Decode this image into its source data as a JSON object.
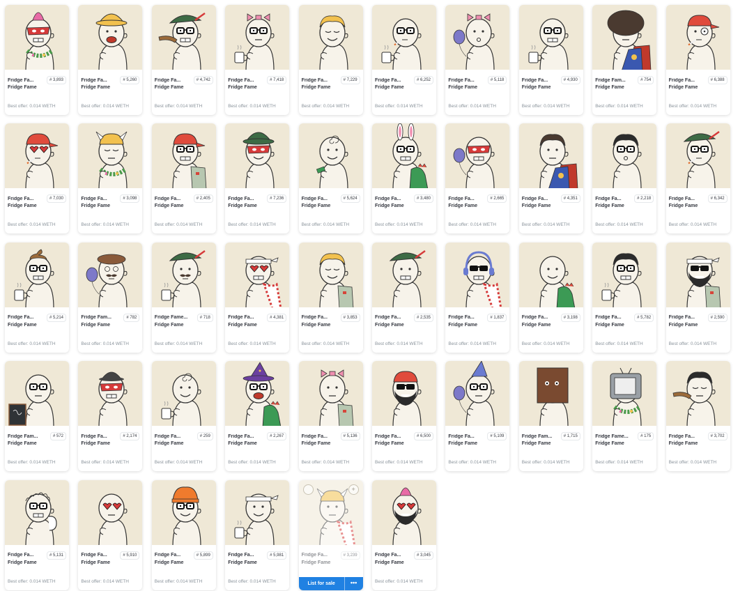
{
  "collection": "Fridge Fame",
  "offer_text": "Best offer: 0.014 WETH",
  "hover_actions": {
    "list_for_sale": "List for sale",
    "more": "•••",
    "left_icon": "circle-icon",
    "right_icon": "plus-icon"
  },
  "hovered_index": 44,
  "items": [
    {
      "name": "Fridge Fa...",
      "number": "# 3,893",
      "hat": "mohawk",
      "hatColor": "#e86aa6",
      "eyes": "mask",
      "mouth": "teeth",
      "extra": "lei"
    },
    {
      "name": "Fridge Fa...",
      "number": "# 5,260",
      "hat": "bucket",
      "hatColor": "#f2c14e",
      "eyes": "dots",
      "mouth": "open",
      "extra": ""
    },
    {
      "name": "Fridge Fa...",
      "number": "# 4,742",
      "hat": "feather",
      "hatColor": "#3d6b45",
      "eyes": "glasses",
      "mouth": "teeth",
      "extra": "boomerang"
    },
    {
      "name": "Fridge Fa...",
      "number": "# 7,418",
      "hat": "bow",
      "hatColor": "#f08fb0",
      "eyes": "glasses",
      "mouth": "flat",
      "extra": "mug"
    },
    {
      "name": "Fridge Fa...",
      "number": "# 7,229",
      "hat": "hair",
      "hatColor": "#f2c14e",
      "eyes": "closed",
      "mouth": "smile",
      "extra": ""
    },
    {
      "name": "Fridge Fa...",
      "number": "# 6,252",
      "hat": "none",
      "hatColor": "",
      "eyes": "glasses",
      "mouth": "cig",
      "extra": "mug"
    },
    {
      "name": "Fridge Fa...",
      "number": "# 5,118",
      "hat": "bow",
      "hatColor": "#f08fb0",
      "eyes": "dots",
      "mouth": "o",
      "extra": "balloon"
    },
    {
      "name": "Fridge Fa...",
      "number": "# 4,930",
      "hat": "none",
      "hatColor": "",
      "eyes": "glasses",
      "mouth": "teeth",
      "extra": "mug"
    },
    {
      "name": "Fridge Fam...",
      "number": "# 754",
      "hat": "afro",
      "hatColor": "#4a3a30",
      "eyes": "glasses",
      "mouth": "flat",
      "extra": "cape"
    },
    {
      "name": "Fridge Fa...",
      "number": "# 6,388",
      "hat": "cap",
      "hatColor": "#e04b3c",
      "eyes": "monocle",
      "mouth": "cig",
      "extra": ""
    },
    {
      "name": "Fridge Fa...",
      "number": "# 7,030",
      "hat": "cap",
      "hatColor": "#e04b3c",
      "eyes": "hearts",
      "mouth": "cig",
      "extra": ""
    },
    {
      "name": "Fridge Fa...",
      "number": "# 3,098",
      "hat": "horns",
      "hatColor": "#f2c14e",
      "eyes": "closed",
      "mouth": "flat",
      "extra": "lei"
    },
    {
      "name": "Fridge Fa...",
      "number": "# 2,405",
      "hat": "cap",
      "hatColor": "#e04b3c",
      "eyes": "glasses",
      "mouth": "teeth",
      "extra": "vest"
    },
    {
      "name": "Fridge Fa...",
      "number": "# 7,236",
      "hat": "bucket",
      "hatColor": "#3d6b45",
      "eyes": "mask",
      "mouth": "smile",
      "extra": ""
    },
    {
      "name": "Fridge Fa...",
      "number": "# 5,624",
      "hat": "swirl",
      "hatColor": "",
      "eyes": "dots",
      "mouth": "smile",
      "extra": "money"
    },
    {
      "name": "Fridge Fa...",
      "number": "# 3,480",
      "hat": "bunny",
      "hatColor": "#f08fb0",
      "eyes": "glasses",
      "mouth": "teeth",
      "extra": "dino"
    },
    {
      "name": "Fridge Fa...",
      "number": "# 2,665",
      "hat": "none",
      "hatColor": "",
      "eyes": "mask",
      "mouth": "teeth",
      "extra": "balloon"
    },
    {
      "name": "Fridge Fa...",
      "number": "# 4,351",
      "hat": "hair",
      "hatColor": "#4a3a30",
      "eyes": "dots",
      "mouth": "flat",
      "extra": "cape"
    },
    {
      "name": "Fridge Fa...",
      "number": "# 2,218",
      "hat": "hair",
      "hatColor": "#2b2b2b",
      "eyes": "glasses",
      "mouth": "o",
      "extra": ""
    },
    {
      "name": "Fridge Fa...",
      "number": "# 6,342",
      "hat": "feather",
      "hatColor": "#3d6b45",
      "eyes": "glasses",
      "mouth": "cig",
      "extra": ""
    },
    {
      "name": "Fridge Fa...",
      "number": "# 5,214",
      "hat": "poop",
      "hatColor": "#9c6b3a",
      "eyes": "glasses",
      "mouth": "teeth",
      "extra": "mug"
    },
    {
      "name": "Fridge Fam...",
      "number": "# 782",
      "hat": "beret",
      "hatColor": "#8a5a3a",
      "eyes": "swirl",
      "mouth": "stache",
      "extra": "balloon"
    },
    {
      "name": "Fridge Fame...",
      "number": "# 718",
      "hat": "feather",
      "hatColor": "#3d6b45",
      "eyes": "dots",
      "mouth": "stache",
      "extra": "mug"
    },
    {
      "name": "Fridge Fa...",
      "number": "# 4,381",
      "hat": "headband",
      "hatColor": "#ffffff",
      "eyes": "hearts",
      "mouth": "teeth",
      "extra": "scarf"
    },
    {
      "name": "Fridge Fa...",
      "number": "# 3,853",
      "hat": "hair",
      "hatColor": "#f2c14e",
      "eyes": "closed",
      "mouth": "smile",
      "extra": "vest"
    },
    {
      "name": "Fridge Fa...",
      "number": "# 2,535",
      "hat": "feather",
      "hatColor": "#3d6b45",
      "eyes": "dots",
      "mouth": "teeth",
      "extra": ""
    },
    {
      "name": "Fridge Fa...",
      "number": "# 1,837",
      "hat": "headphones",
      "hatColor": "#6a7bd1",
      "eyes": "shades",
      "mouth": "teeth",
      "extra": "scarf"
    },
    {
      "name": "Fridge Fa...",
      "number": "# 3,198",
      "hat": "none",
      "hatColor": "",
      "eyes": "dots",
      "mouth": "smile",
      "extra": "dino"
    },
    {
      "name": "Fridge Fa...",
      "number": "# 5,782",
      "hat": "hair",
      "hatColor": "#2b2b2b",
      "eyes": "glasses",
      "mouth": "teeth",
      "extra": "mug"
    },
    {
      "name": "Fridge Fa...",
      "number": "# 2,590",
      "hat": "headband",
      "hatColor": "#ffffff",
      "eyes": "shades",
      "mouth": "beard",
      "extra": "vest"
    },
    {
      "name": "Fridge Fam...",
      "number": "# 572",
      "hat": "none",
      "hatColor": "",
      "eyes": "glasses",
      "mouth": "flat",
      "extra": "board"
    },
    {
      "name": "Fridge Fa...",
      "number": "# 2,174",
      "hat": "bowler",
      "hatColor": "#444444",
      "eyes": "mask",
      "mouth": "teeth",
      "extra": ""
    },
    {
      "name": "Fridge Fa...",
      "number": "# 259",
      "hat": "swirl",
      "hatColor": "",
      "eyes": "dots",
      "mouth": "smile",
      "extra": "mug"
    },
    {
      "name": "Fridge Fa...",
      "number": "# 2,267",
      "hat": "wizard",
      "hatColor": "#6b3fa0",
      "eyes": "glasses",
      "mouth": "open",
      "extra": "dino"
    },
    {
      "name": "Fridge Fa...",
      "number": "# 5,136",
      "hat": "bow",
      "hatColor": "#f08fb0",
      "eyes": "dots",
      "mouth": "flat",
      "extra": "vest"
    },
    {
      "name": "Fridge Fa...",
      "number": "# 6,500",
      "hat": "bandana",
      "hatColor": "#e04b3c",
      "eyes": "shades",
      "mouth": "beard",
      "extra": ""
    },
    {
      "name": "Fridge Fa...",
      "number": "# 5,109",
      "hat": "party",
      "hatColor": "#6a7bd1",
      "eyes": "glasses",
      "mouth": "flat",
      "extra": "balloon"
    },
    {
      "name": "Fridge Fam...",
      "number": "# 1,715",
      "hat": "bag",
      "hatColor": "#7a4a30",
      "eyes": "dots",
      "mouth": "flat",
      "extra": ""
    },
    {
      "name": "Fridge Fame...",
      "number": "# 175",
      "hat": "tv",
      "hatColor": "#9aa0a6",
      "eyes": "mask",
      "mouth": "teeth",
      "extra": "lei"
    },
    {
      "name": "Fridge Fa...",
      "number": "# 3,702",
      "hat": "hair",
      "hatColor": "#2b2b2b",
      "eyes": "closed",
      "mouth": "flat",
      "extra": "boomerang"
    },
    {
      "name": "Fridge Fa...",
      "number": "# 5,131",
      "hat": "curly",
      "hatColor": "",
      "eyes": "glasses",
      "mouth": "teeth",
      "extra": "cast"
    },
    {
      "name": "Fridge Fa...",
      "number": "# 5,910",
      "hat": "none",
      "hatColor": "",
      "eyes": "hearts",
      "mouth": "flat",
      "extra": ""
    },
    {
      "name": "Fridge Fa...",
      "number": "# 5,899",
      "hat": "beanie",
      "hatColor": "#ef7b2d",
      "eyes": "glasses",
      "mouth": "smile",
      "extra": ""
    },
    {
      "name": "Fridge Fa...",
      "number": "# 5,981",
      "hat": "headband",
      "hatColor": "#ffffff",
      "eyes": "dots",
      "mouth": "smile",
      "extra": "mug"
    },
    {
      "name": "Fridge Fa...",
      "number": "# 3,239",
      "hat": "horns",
      "hatColor": "#f2c14e",
      "eyes": "dots",
      "mouth": "flat",
      "extra": "scarf"
    },
    {
      "name": "Fridge Fa...",
      "number": "# 3,045",
      "hat": "mohawk",
      "hatColor": "#e86aa6",
      "eyes": "hearts",
      "mouth": "beard",
      "extra": ""
    }
  ]
}
